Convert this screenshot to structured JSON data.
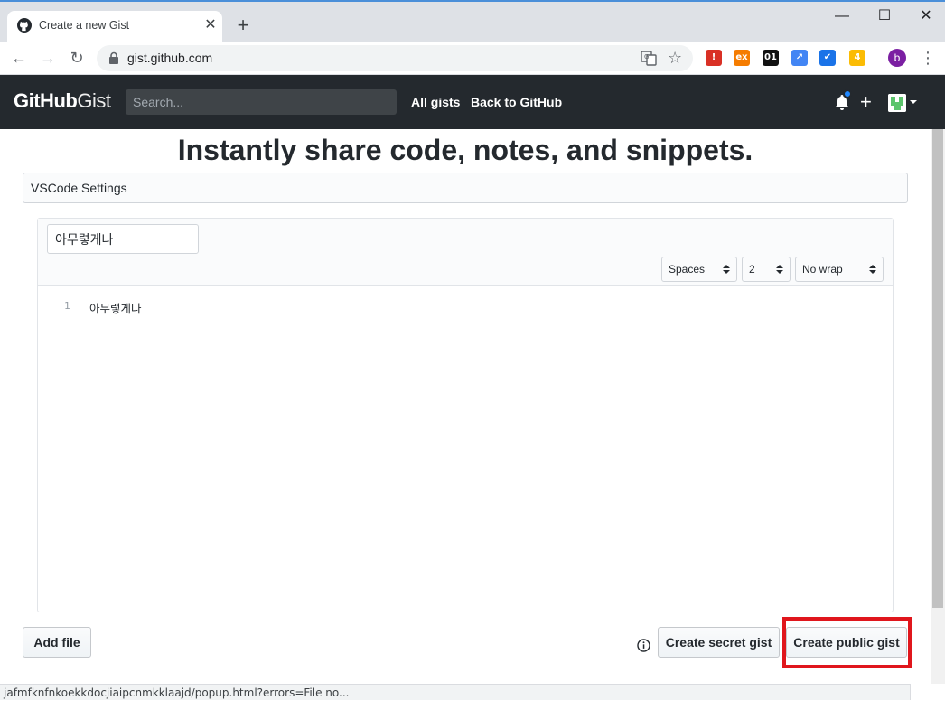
{
  "browser": {
    "tab_title": "Create a new Gist",
    "tab_close": "✕",
    "new_tab": "+",
    "window_controls": {
      "minimize": "—",
      "maximize": "☐",
      "close": "✕"
    },
    "url": "gist.github.com",
    "extensions": [
      {
        "name": "adblock-icon",
        "label": "!",
        "color": "#d93025"
      },
      {
        "name": "ext-orange-icon",
        "label": "ex",
        "color": "#f57c00"
      },
      {
        "name": "ext-01-icon",
        "label": "01",
        "color": "#111111"
      },
      {
        "name": "ext-chart-icon",
        "label": "↗",
        "color": "#4285f4"
      },
      {
        "name": "ext-check-icon",
        "label": "✔",
        "color": "#1a73e8"
      },
      {
        "name": "ext-bulb-icon",
        "label": "4",
        "color": "#fbbc04"
      }
    ],
    "profile_initial": "b",
    "status_text": "jafmfknfnkoekkdocjiaipcnmkklaajd/popup.html?errors=File no..."
  },
  "header": {
    "logo_bold": "GitHub",
    "logo_light": "Gist",
    "search_placeholder": "Search...",
    "nav": {
      "all_gists": "All gists",
      "back_to_github": "Back to GitHub"
    },
    "plus_label": "+"
  },
  "main": {
    "title": "Instantly share code, notes, and snippets.",
    "description_value": "VSCode Settings",
    "file": {
      "filename_value": "아무렇게나",
      "indent_mode": "Spaces",
      "indent_size": "2",
      "wrap_mode": "No wrap",
      "lines": [
        {
          "number": "1",
          "text": "아무렇게나"
        }
      ]
    },
    "buttons": {
      "add_file": "Add file",
      "create_secret": "Create secret gist",
      "create_public": "Create public gist"
    }
  },
  "colors": {
    "header_bg": "#24292e",
    "highlight": "#e0161c",
    "notification_dot": "#2188ff"
  }
}
